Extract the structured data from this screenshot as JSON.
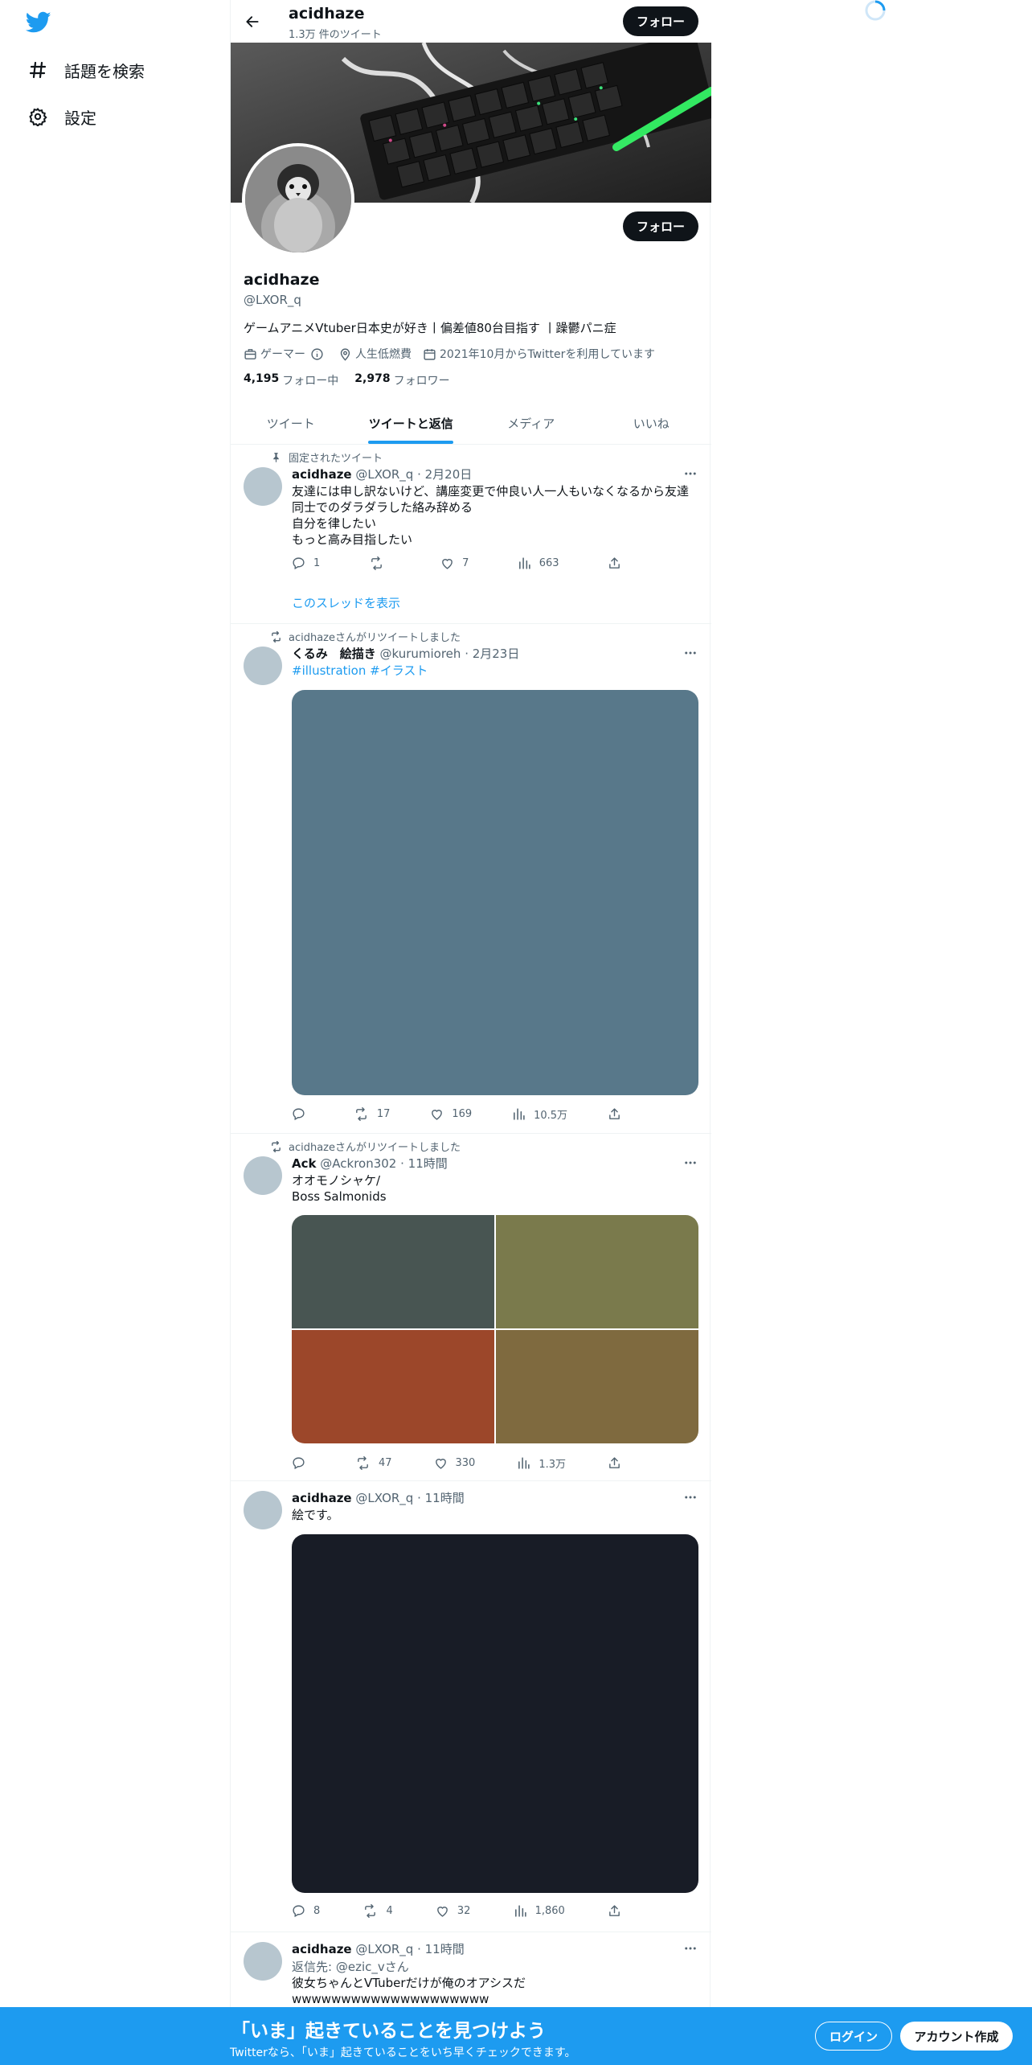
{
  "nav": {
    "explore_label": "話題を検索",
    "settings_label": "設定"
  },
  "header": {
    "name": "acidhaze",
    "tweet_count": "1.3万 件のツイート",
    "follow_label": "フォロー"
  },
  "profile": {
    "follow_label": "フォロー",
    "name": "acidhaze",
    "handle": "@LXOR_q",
    "bio": "ゲームアニメVtuber日本史が好き丨偏差値80台目指す 丨躁鬱パニ症",
    "category": "ゲーマー",
    "location": "人生低燃費",
    "joined": "2021年10月からTwitterを利用しています",
    "following_count": "4,195",
    "following_label": "フォロー中",
    "followers_count": "2,978",
    "followers_label": "フォロワー"
  },
  "tabs": [
    "ツイート",
    "ツイートと返信",
    "メディア",
    "いいね"
  ],
  "tweets": [
    {
      "context": "固定されたツイート",
      "name": "acidhaze",
      "meta": "@LXOR_q · 2月20日",
      "text": "友達には申し訳ないけど、講座変更で仲良い人一人もいなくなるから友達\n同士でのダラダラした絡み辞める\n自分を律したい\nもっと高み目指したい",
      "replies": "1",
      "retweets": "",
      "likes": "7",
      "views": "663",
      "thread_link": "このスレッドを表示"
    },
    {
      "context": "acidhazeさんがリツイートしました",
      "name": "くるみ　絵描き",
      "meta": "@kurumioreh · 2月23日",
      "text": "#illustration #イラスト",
      "replies": "",
      "retweets": "17",
      "likes": "169",
      "views": "10.5万",
      "media_color": "#58788a"
    },
    {
      "context": "acidhazeさんがリツイートしました",
      "name": "Ack",
      "meta": "@Ackron302 · 11時間",
      "text": "オオモノシャケ/\nBoss Salmonids",
      "replies": "",
      "retweets": "47",
      "likes": "330",
      "views": "1.3万",
      "media_colors": [
        "#485552",
        "#7a7a4c",
        "#9c472a",
        "#7f6a3f"
      ]
    },
    {
      "name": "acidhaze",
      "meta": "@LXOR_q · 11時間",
      "text": "絵です。",
      "replies": "8",
      "retweets": "4",
      "likes": "32",
      "views": "1,860",
      "media_color": "#181c26"
    },
    {
      "name": "acidhaze",
      "meta": "@LXOR_q · 11時間",
      "reply_prefix": "返信先:",
      "reply_to": "@ezic_v",
      "reply_suffix": "さん",
      "text": "彼女ちゃんとVTuberだけが俺のオアシスだwwwwwwwwwwwwwwwwwwww"
    }
  ],
  "bottom": {
    "title": "「いま」起きていることを見つけよう",
    "subtitle": "Twitterなら、「いま」起きていることをいち早くチェックできます。",
    "login": "ログイン",
    "signup": "アカウント作成"
  },
  "colors": {
    "accent": "#1d9bf0",
    "dark": "#0f1419",
    "muted": "#536471"
  }
}
